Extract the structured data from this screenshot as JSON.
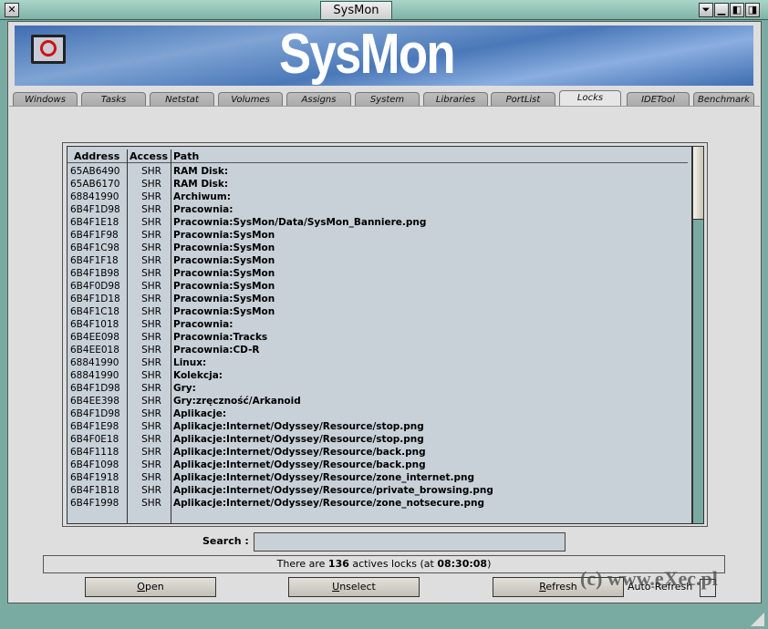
{
  "window": {
    "title": "SysMon",
    "close": "✕",
    "buttons": [
      "⏷",
      "▁",
      "◧",
      "◨"
    ]
  },
  "banner": {
    "title": "SysMon"
  },
  "tabs": [
    "Windows",
    "Tasks",
    "Netstat",
    "Volumes",
    "Assigns",
    "System",
    "Libraries",
    "PortList",
    "Locks",
    "IDETool",
    "Benchmark"
  ],
  "active_tab": "Locks",
  "list": {
    "columns": [
      "Address",
      "Access",
      "Path"
    ],
    "rows": [
      [
        "65AB6490",
        "SHR",
        "RAM Disk:"
      ],
      [
        "65AB6170",
        "SHR",
        "RAM Disk:"
      ],
      [
        "68841990",
        "SHR",
        "Archiwum:"
      ],
      [
        "6B4F1D98",
        "SHR",
        "Pracownia:"
      ],
      [
        "6B4F1E18",
        "SHR",
        "Pracownia:SysMon/Data/SysMon_Banniere.png"
      ],
      [
        "6B4F1F98",
        "SHR",
        "Pracownia:SysMon"
      ],
      [
        "6B4F1C98",
        "SHR",
        "Pracownia:SysMon"
      ],
      [
        "6B4F1F18",
        "SHR",
        "Pracownia:SysMon"
      ],
      [
        "6B4F1B98",
        "SHR",
        "Pracownia:SysMon"
      ],
      [
        "6B4F0D98",
        "SHR",
        "Pracownia:SysMon"
      ],
      [
        "6B4F1D18",
        "SHR",
        "Pracownia:SysMon"
      ],
      [
        "6B4F1C18",
        "SHR",
        "Pracownia:SysMon"
      ],
      [
        "6B4F1018",
        "SHR",
        "Pracownia:"
      ],
      [
        "6B4EE098",
        "SHR",
        "Pracownia:Tracks"
      ],
      [
        "6B4EE018",
        "SHR",
        "Pracownia:CD-R"
      ],
      [
        "68841990",
        "SHR",
        "Linux:"
      ],
      [
        "68841990",
        "SHR",
        "Kolekcja:"
      ],
      [
        "6B4F1D98",
        "SHR",
        "Gry:"
      ],
      [
        "6B4EE398",
        "SHR",
        "Gry:zręczność/Arkanoid"
      ],
      [
        "6B4F1D98",
        "SHR",
        "Aplikacje:"
      ],
      [
        "6B4F1E98",
        "SHR",
        "Aplikacje:Internet/Odyssey/Resource/stop.png"
      ],
      [
        "6B4F0E18",
        "SHR",
        "Aplikacje:Internet/Odyssey/Resource/stop.png"
      ],
      [
        "6B4F1118",
        "SHR",
        "Aplikacje:Internet/Odyssey/Resource/back.png"
      ],
      [
        "6B4F1098",
        "SHR",
        "Aplikacje:Internet/Odyssey/Resource/back.png"
      ],
      [
        "6B4F1918",
        "SHR",
        "Aplikacje:Internet/Odyssey/Resource/zone_internet.png"
      ],
      [
        "6B4F1B18",
        "SHR",
        "Aplikacje:Internet/Odyssey/Resource/private_browsing.png"
      ],
      [
        "6B4F1998",
        "SHR",
        "Aplikacje:Internet/Odyssey/Resource/zone_notsecure.png"
      ]
    ]
  },
  "search": {
    "label": "Search :",
    "value": ""
  },
  "status": {
    "prefix": "There are ",
    "count": "136",
    "middle": " actives locks (at ",
    "time": "08:30:08",
    "suffix": ")"
  },
  "buttons": {
    "open": "Open",
    "unselect": "Unselect",
    "refresh": "Refresh"
  },
  "auto_refresh": {
    "label": "Auto-Refresh",
    "checked": false
  },
  "watermark": "(c) www.eXec.pl"
}
